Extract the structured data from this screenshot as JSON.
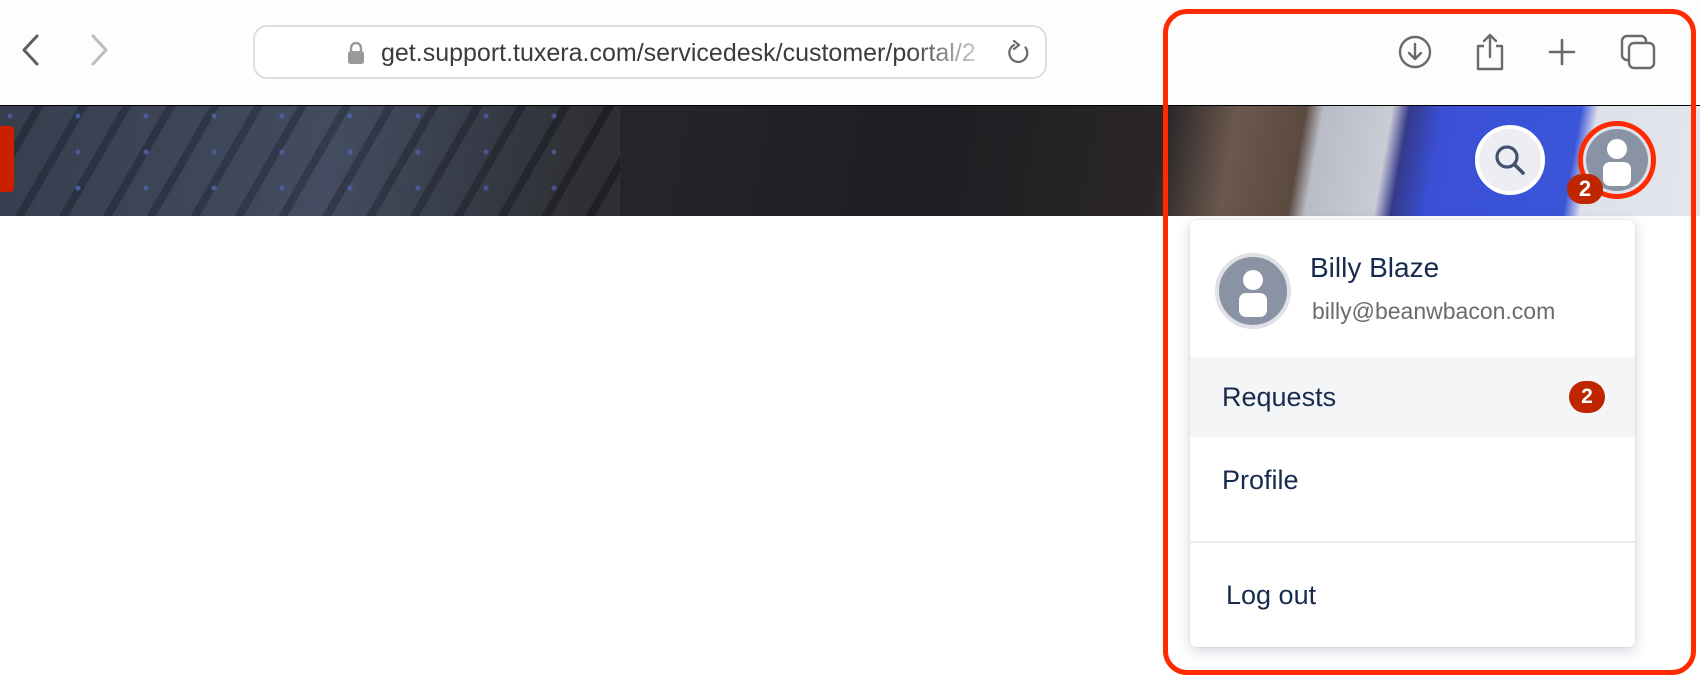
{
  "browser": {
    "url": "get.support.tuxera.com/servicedesk/customer/portal/2",
    "icons": {
      "back": "chevron-left-icon",
      "forward": "chevron-right-icon",
      "lock": "lock-icon",
      "reload": "reload-icon",
      "download": "download-icon",
      "share": "share-icon",
      "new_tab": "plus-icon",
      "tabs": "tabs-overview-icon"
    }
  },
  "header": {
    "search_icon": "search-icon",
    "avatar_icon": "user-avatar-icon",
    "notification_count": "2"
  },
  "user_menu": {
    "name": "Billy Blaze",
    "email": "billy@beanwbacon.com",
    "items": [
      {
        "label": "Requests",
        "badge": "2"
      },
      {
        "label": "Profile"
      },
      {
        "label": "Log out"
      }
    ]
  },
  "colors": {
    "highlight": "#ff2a00",
    "badge": "#bf2600",
    "text_primary": "#172b4d",
    "hover_bg": "#f4f5f7"
  }
}
